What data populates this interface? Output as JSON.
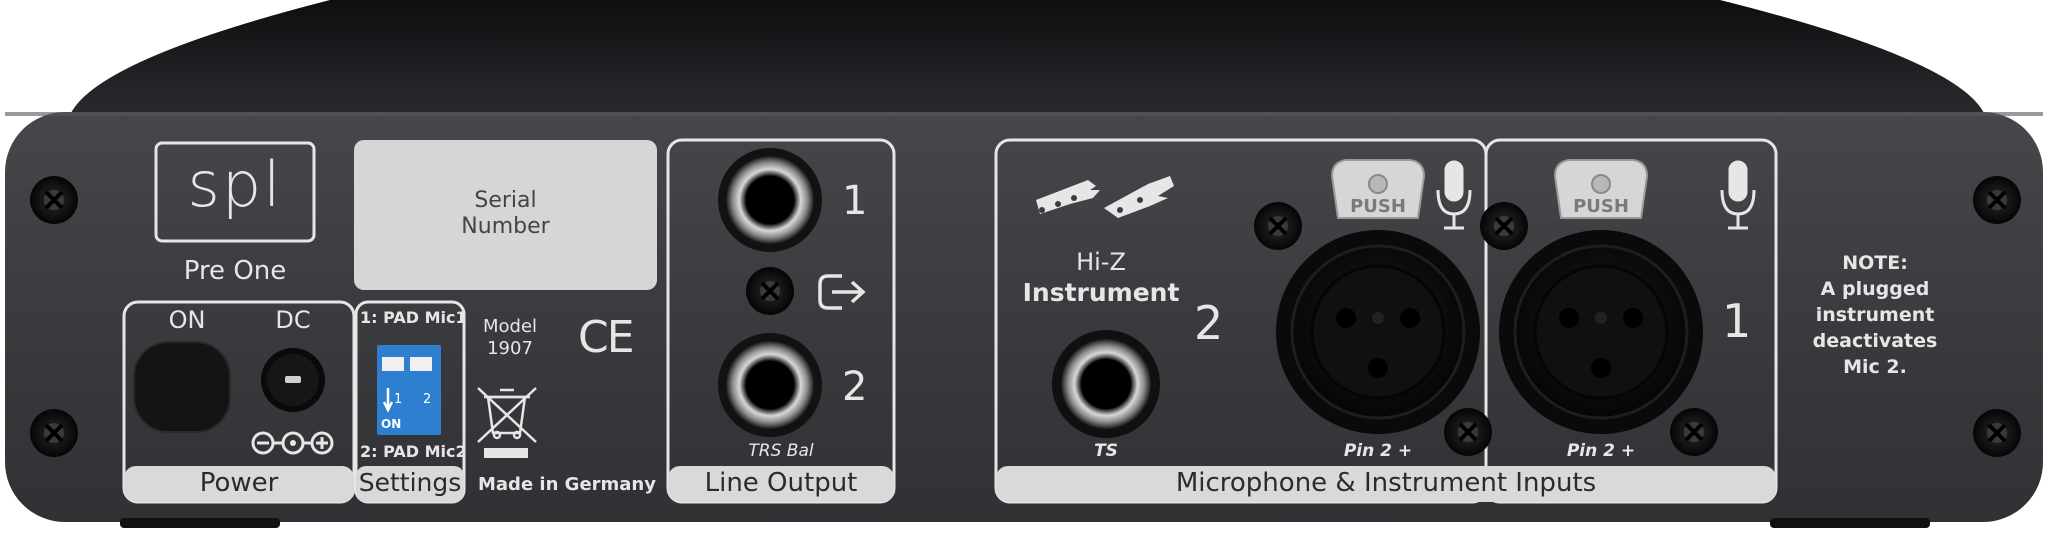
{
  "brand": {
    "logo_text": "spl",
    "product_name": "Pre One"
  },
  "serial_label": {
    "line1": "Serial",
    "line2": "Number"
  },
  "power": {
    "on_label": "ON",
    "dc_label": "DC",
    "section_label": "Power"
  },
  "settings": {
    "switch1_label": "1: PAD Mic1",
    "switch2_label": "2: PAD Mic2",
    "dip_on": "ON",
    "dip_1": "1",
    "dip_2": "2",
    "section_label": "Settings"
  },
  "model": {
    "line1": "Model",
    "line2": "1907",
    "ce_mark": "CE",
    "made_in": "Made in Germany"
  },
  "line_output": {
    "jack1_number": "1",
    "jack2_number": "2",
    "type_label": "TRS Bal",
    "section_label": "Line Output"
  },
  "inputs": {
    "hiz_line1": "Hi-Z",
    "hiz_line2": "Instrument",
    "ts_label": "TS",
    "channel2_number": "2",
    "channel1_number": "1",
    "push_label": "PUSH",
    "pin_label_2": "Pin 2 +",
    "pin_label_1": "Pin 2 +",
    "section_label": "Microphone & Instrument Inputs"
  },
  "note": {
    "title": "NOTE:",
    "line1": "A plugged",
    "line2": "instrument",
    "line3": "deactivates",
    "line4": "Mic 2."
  },
  "colors": {
    "panel": "#3a3b3d",
    "chassis_top": "#17181a",
    "silkscreen": "#e6e6e6",
    "label_tab": "#d9d9d9",
    "dip_switch": "#2f7fd1"
  }
}
